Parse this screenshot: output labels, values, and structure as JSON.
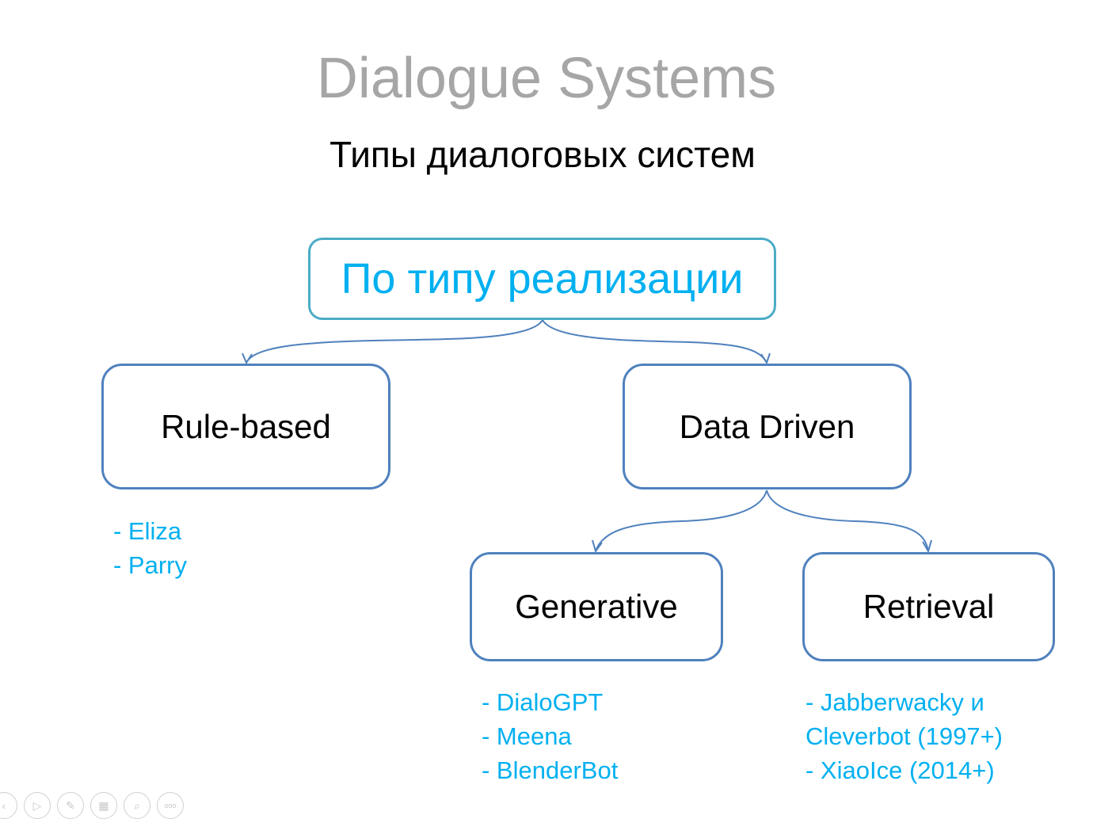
{
  "slide": {
    "title": "Dialogue Systems",
    "subtitle": "Типы диалоговых систем"
  },
  "diagram": {
    "root": {
      "label": "По типу реализации"
    },
    "nodes": {
      "rule_based": {
        "label": "Rule-based",
        "examples": [
          "- Eliza",
          "- Parry"
        ]
      },
      "data_driven": {
        "label": "Data Driven"
      },
      "generative": {
        "label": "Generative",
        "examples": [
          "- DialoGPT",
          "- Meena",
          "- BlenderBot"
        ]
      },
      "retrieval": {
        "label": "Retrieval",
        "examples": [
          "- Jabberwacky и",
          "Cleverbot (1997+)",
          "- XiaoIce (2014+)"
        ]
      }
    },
    "edges": [
      {
        "from": "root",
        "to": "rule_based"
      },
      {
        "from": "root",
        "to": "data_driven"
      },
      {
        "from": "data_driven",
        "to": "generative"
      },
      {
        "from": "data_driven",
        "to": "retrieval"
      }
    ],
    "colors": {
      "box_border": "#4f81bd",
      "root_border": "#4bacc6",
      "accent_text": "#00b0f0",
      "title": "#a6a6a6"
    }
  },
  "toolbar": {
    "buttons": [
      "previous",
      "play",
      "pen",
      "slides",
      "zoom",
      "more"
    ],
    "more_label": "ooo"
  }
}
